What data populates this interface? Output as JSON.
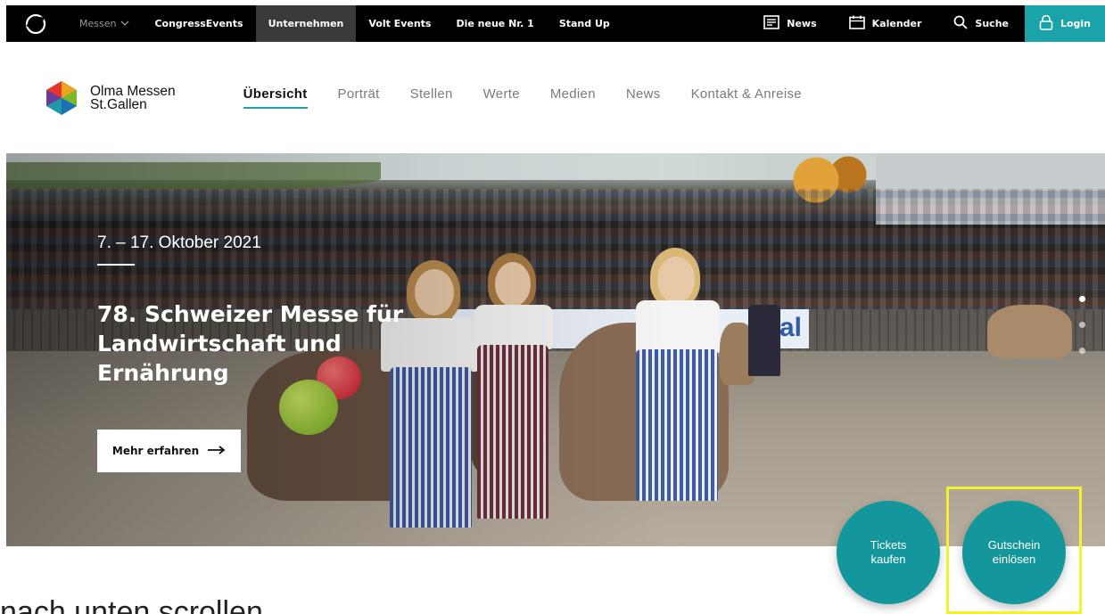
{
  "topbar": {
    "items": [
      {
        "label": "Messen",
        "dim": true
      },
      {
        "label": "CongressEvents"
      },
      {
        "label": "Unternehmen",
        "active": true
      },
      {
        "label": "Volt Events"
      },
      {
        "label": "Die neue Nr. 1"
      },
      {
        "label": "Stand Up"
      }
    ],
    "news_label": "News",
    "calendar_label": "Kalender",
    "search_label": "Suche",
    "login_label": "Login",
    "accent": "#1aa3a8"
  },
  "header": {
    "brand_line1": "Olma Messen",
    "brand_line2": "St.Gallen",
    "nav": [
      {
        "label": "Übersicht",
        "active": true
      },
      {
        "label": "Porträt"
      },
      {
        "label": "Stellen"
      },
      {
        "label": "Werte"
      },
      {
        "label": "Medien"
      },
      {
        "label": "News"
      },
      {
        "label": "Kontakt & Anreise"
      }
    ]
  },
  "hero": {
    "date": "7. – 17. Oktober 2021",
    "title": "78. Schweizer Messe für Landwirtschaft und Ernährung",
    "button_label": "Mehr erfahren",
    "banner_text": "val",
    "slides": 3,
    "active_slide": 1
  },
  "fabs": {
    "tickets_label": "Tickets\nkaufen",
    "gutschein_label": "Gutschein\neinlösen",
    "color": "#14979c"
  },
  "scroll_hint": "nach unten scrollen"
}
